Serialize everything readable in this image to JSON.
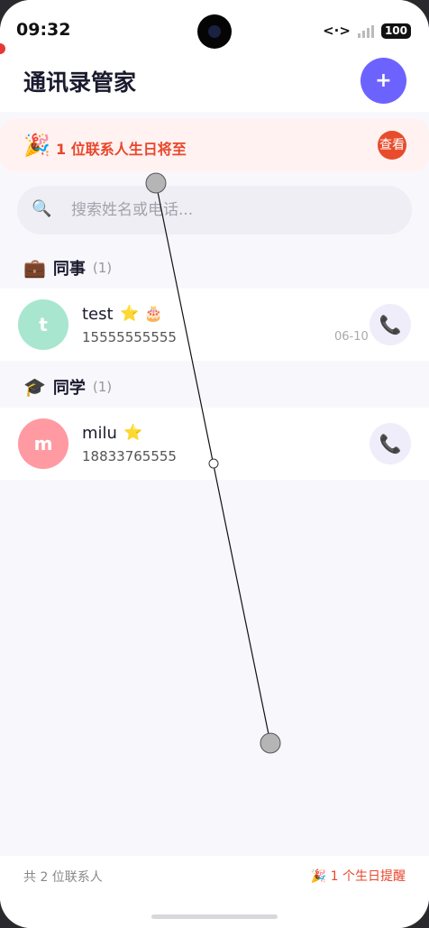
{
  "status": {
    "time": "09:32",
    "net_glyph": "<·>",
    "battery": "100"
  },
  "header": {
    "title": "通讯录管家",
    "action_glyph": "+"
  },
  "banner": {
    "icon": "🎉",
    "text": "1 位联系人生日将至",
    "button": "查看"
  },
  "search": {
    "placeholder": "搜索姓名或电话...",
    "icon": "🔍"
  },
  "groups": [
    {
      "icon": "💼",
      "name": "同事",
      "count": "(1)",
      "contacts": [
        {
          "initial": "t",
          "avatar_color": "#a8e6cf",
          "name": "test",
          "badges": "⭐ 🎂",
          "phone": "15555555555",
          "date": "06-10"
        }
      ]
    },
    {
      "icon": "🎓",
      "name": "同学",
      "count": "(1)",
      "contacts": [
        {
          "initial": "m",
          "avatar_color": "#ff9aa2",
          "name": "milu",
          "badges": "⭐",
          "phone": "18833765555",
          "date": ""
        }
      ]
    }
  ],
  "footer": {
    "left": "共 2 位联系人",
    "right": "🎉 1 个生日提醒"
  },
  "icons": {
    "call": "📞",
    "call_icon_name": "phone-icon",
    "search_icon_name": "search-icon"
  },
  "colors": {
    "accent": "#6c63ff",
    "birthday": "#e8472c"
  }
}
